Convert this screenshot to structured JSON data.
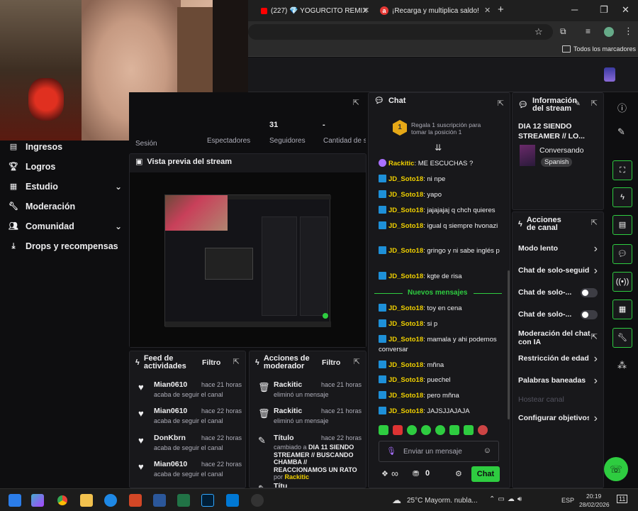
{
  "browser": {
    "tabs": [
      {
        "label": "(227) 💎 YOGURCITO REMIX",
        "icon": "youtube-icon"
      },
      {
        "label": "¡Recarga y multiplica saldo!",
        "icon": "amazon-icon"
      }
    ],
    "new_tab": "+",
    "bookmarks_label": "Todos los marcadores"
  },
  "stats": {
    "value1": "31",
    "value2": "-",
    "label_session": "Sesión",
    "label_viewers": "Espectadores",
    "label_followers": "Seguidores",
    "label_subs": "Cantidad de suscripciones"
  },
  "sidebar": {
    "items": [
      {
        "label": "Ingresos",
        "chevron": false
      },
      {
        "label": "Logros",
        "chevron": false
      },
      {
        "label": "Estudio",
        "chevron": true
      },
      {
        "label": "Moderación",
        "chevron": false
      },
      {
        "label": "Comunidad",
        "chevron": true
      },
      {
        "label": "Drops y recompensas",
        "chevron": false
      }
    ]
  },
  "preview": {
    "title": "Vista previa del stream"
  },
  "feed": {
    "title": "Feed de actividades",
    "filter": "Filtro",
    "items": [
      {
        "name": "Mian0610",
        "time": "hace 21 horas",
        "desc": "acaba de seguir el canal"
      },
      {
        "name": "Mian0610",
        "time": "hace 22 horas",
        "desc": "acaba de seguir el canal"
      },
      {
        "name": "DonKbrn",
        "time": "hace 22 horas",
        "desc": "acaba de seguir el canal"
      },
      {
        "name": "Mian0610",
        "time": "hace 22 horas",
        "desc": "acaba de seguir el canal"
      }
    ]
  },
  "modactions": {
    "title": "Acciones de moderador",
    "filter": "Filtro",
    "items": [
      {
        "name": "Rackitic",
        "time": "hace 21 horas",
        "desc": "eliminó un mensaje"
      },
      {
        "name": "Rackitic",
        "time": "hace 21 horas",
        "desc": "eliminó un mensaje"
      }
    ],
    "title_change": {
      "name": "Título",
      "time": "hace 22 horas",
      "prefix": "cambiado a",
      "new_title": "DIA 11 SIENDO STREAMER // BUSCANDO CHAMBA // REACCIONAMOS UN RATO",
      "by": "por",
      "user": "Rackitic"
    },
    "cutoff": "Títu"
  },
  "chat": {
    "title": "Chat",
    "gift_text": "Regala 1 suscripción para tomar la posición 1",
    "gift_rank": "1",
    "messages": [
      {
        "user": "Rackitic",
        "text": "ME ESCUCHAS ?",
        "color": "#f0d000",
        "badge": "mic"
      },
      {
        "user": "JD_Soto18",
        "text": "ni npe"
      },
      {
        "user": "JD_Soto18",
        "text": "yapo"
      },
      {
        "user": "JD_Soto18",
        "text": "jajajajaj q chch quieres"
      },
      {
        "user": "JD_Soto18",
        "text": "igual q siempre hvonazi"
      },
      {
        "user": "JD_Soto18",
        "text": "gringo y ni sabe inglés p"
      },
      {
        "user": "JD_Soto18",
        "text": "kgte de risa"
      }
    ],
    "new_messages_label": "Nuevos mensajes",
    "new_messages": [
      {
        "user": "JD_Soto18",
        "text": "toy en cena"
      },
      {
        "user": "JD_Soto18",
        "text": "si p"
      },
      {
        "user": "JD_Soto18",
        "text": "mamala y ahi podemos conversar"
      },
      {
        "user": "JD_Soto18",
        "text": "mñna"
      },
      {
        "user": "JD_Soto18",
        "text": "puechel"
      },
      {
        "user": "JD_Soto18",
        "text": "pero mñna"
      },
      {
        "user": "JD_Soto18",
        "text": "JAJSJJAJAJA"
      }
    ],
    "input_placeholder": "Enviar un mensaje",
    "points": "0",
    "send_label": "Chat",
    "infinity": "∞"
  },
  "stream_info": {
    "title": "Información del stream",
    "stream_title": "DIA 12 SIENDO STREAMER // LO...",
    "category": "Conversando",
    "tag": "Spanish"
  },
  "channel_actions": {
    "title": "Acciones de canal",
    "items": [
      {
        "label": "Modo lento",
        "kind": "chevron"
      },
      {
        "label": "Chat de solo-seguido",
        "kind": "chevron"
      },
      {
        "label": "Chat de solo-...",
        "kind": "toggle"
      },
      {
        "label": "Chat de solo-...",
        "kind": "toggle"
      },
      {
        "label": "Moderación del chat con IA",
        "kind": "external"
      },
      {
        "label": "Restricción de edad",
        "kind": "chevron"
      },
      {
        "label": "Palabras baneadas",
        "kind": "chevron"
      },
      {
        "label": "Hostear canal",
        "kind": "disabled"
      },
      {
        "label": "Configurar objetivos",
        "kind": "chevron"
      }
    ]
  },
  "taskbar": {
    "weather": "25°C  Mayorm. nubla...",
    "lang": "ESP",
    "time": "20:19",
    "date": "28/02/2026",
    "notif": "11"
  },
  "colors": {
    "accent": "#2ecc40",
    "user": "#f0d000",
    "bg": "#0e0e10"
  }
}
